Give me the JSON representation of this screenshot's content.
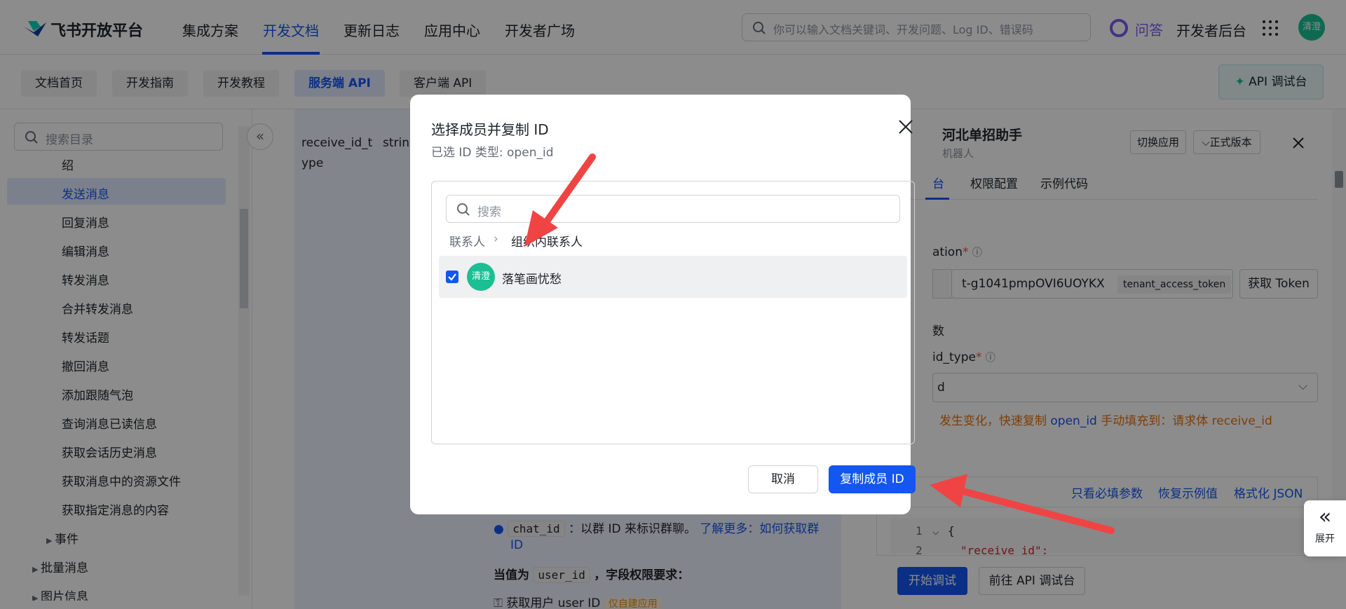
{
  "topnav": {
    "brand": "飞书开放平台",
    "links": [
      "集成方案",
      "开发文档",
      "更新日志",
      "应用中心",
      "开发者广场"
    ],
    "search_placeholder": "你可以输入文档关键词、开发问题、Log ID、错误码",
    "ask": "问答",
    "dev_backend": "开发者后台",
    "avatar": "清澄"
  },
  "subnav": {
    "tabs": [
      "文档首页",
      "开发指南",
      "开发教程",
      "服务端 API",
      "客户端 API"
    ],
    "api_console": "API 调试台"
  },
  "sidebar": {
    "search_placeholder": "搜索目录",
    "items": [
      "绍",
      "发送消息",
      "回复消息",
      "编辑消息",
      "转发消息",
      "合并转发消息",
      "转发话题",
      "撤回消息",
      "添加跟随气泡",
      "查询消息已读信息",
      "获取会话历史消息",
      "获取消息中的资源文件",
      "获取指定消息的内容"
    ],
    "groups": [
      "事件",
      "批量消息",
      "图片信息"
    ]
  },
  "main": {
    "param_name": "receive_id_t",
    "param_name2": "ype",
    "param_type": "string",
    "chat_id_code": "chat_id",
    "chat_id_text": "：以群 ID 来标识群聊。",
    "chat_id_link": "了解更多：如何获取群",
    "chat_id_link2": "ID",
    "when_label": "当值为",
    "user_id_code": "user_id",
    "when_suffix": "，字段权限要求：",
    "perm_text": "获取用户 user ID",
    "perm_badge": "仅自建应用"
  },
  "rpanel": {
    "title": "河北单招助手",
    "subtitle": "机器人",
    "switch_app": "切换应用",
    "version": "正式版本",
    "tabs": [
      "台",
      "权限配置",
      "示例代码"
    ],
    "auth_label": "ation",
    "token_value": "t-g1041pmpOVI6UOYKX",
    "token_tag": "tenant_access_token",
    "get_token": "获取 Token",
    "params_label": "数",
    "id_type_label": "id_type",
    "select_value": "d",
    "warn_text": "发生变化，快速复制",
    "warn_link": "open_id",
    "warn_text2": "手动填充到：请求体 receive_id",
    "json_links": [
      "只看必填参数",
      "恢复示例值",
      "格式化 JSON"
    ],
    "code_lines": [
      "{",
      "\"receive_id\":"
    ],
    "line_numbers": [
      "1",
      "2"
    ],
    "start": "开始调试",
    "goto": "前往 API 调试台",
    "expand": "展开"
  },
  "modal": {
    "title": "选择成员并复制 ID",
    "subtitle": "已选 ID 类型: open_id",
    "search_placeholder": "搜索",
    "crumb_root": "联系人",
    "crumb_current": "组织内联系人",
    "member_avatar": "清澄",
    "member_name": "落笔画忧愁",
    "cancel": "取消",
    "copy": "复制成员 ID"
  },
  "colors": {
    "accent": "#1456f0",
    "avatar": "#1bbf94",
    "warn": "#e8720b",
    "arrow": "#f04444"
  }
}
